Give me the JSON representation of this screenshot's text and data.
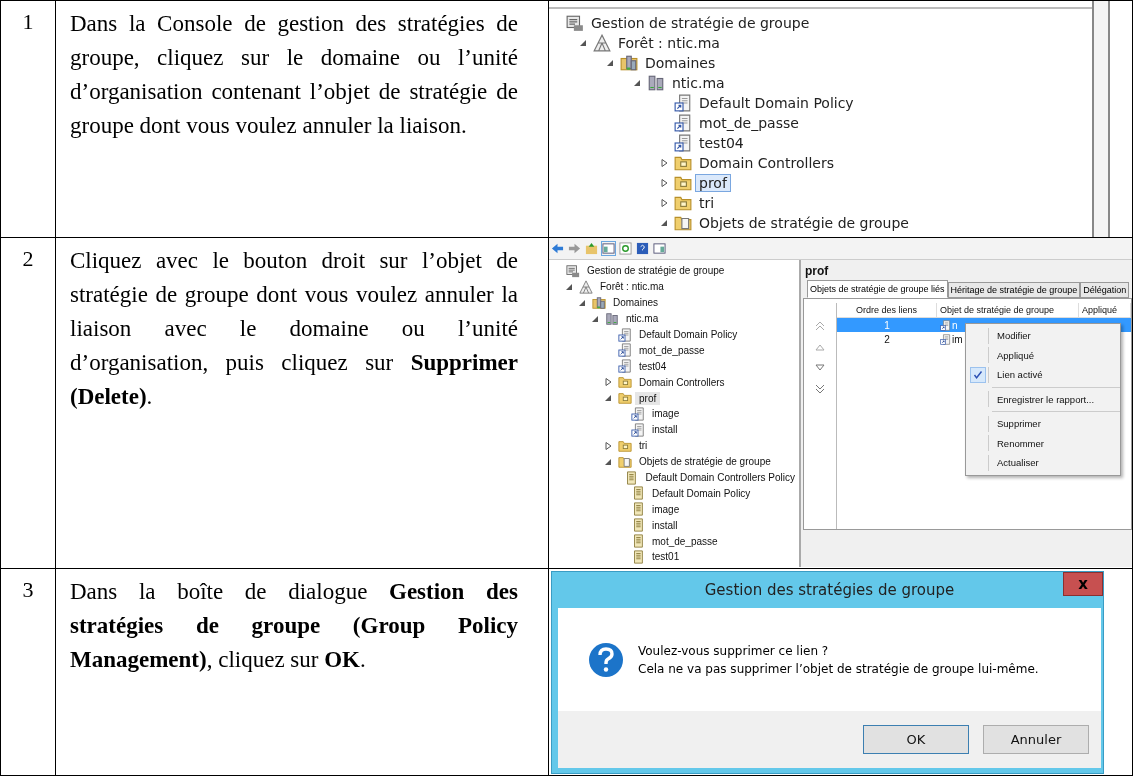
{
  "steps": [
    {
      "number": "1",
      "instruction": "Dans la Console de gestion des stratégies de groupe, cliquez sur le domaine ou l’unité d’organisation contenant l’objet de stratégie de groupe dont vous voulez annuler la liaison.",
      "screen": {
        "kind": "tree",
        "tree": [
          {
            "label": "Gestion de stratégie de groupe",
            "kind": "console",
            "selected": false,
            "children": [
              {
                "label": "Forêt : ntic.ma",
                "kind": "forest",
                "expanded": true,
                "selected": false,
                "children": [
                  {
                    "label": "Domaines",
                    "kind": "domains",
                    "expanded": true,
                    "selected": false,
                    "children": [
                      {
                        "label": "ntic.ma",
                        "kind": "domain",
                        "expanded": true,
                        "selected": false,
                        "children": [
                          {
                            "label": "Default Domain Policy",
                            "kind": "gpo-link",
                            "selected": false
                          },
                          {
                            "label": "mot_de_passe",
                            "kind": "gpo-link",
                            "selected": false
                          },
                          {
                            "label": "test04",
                            "kind": "gpo-link",
                            "selected": false
                          },
                          {
                            "label": "Domain Controllers",
                            "kind": "ou",
                            "expanded": false,
                            "selected": false
                          },
                          {
                            "label": "prof",
                            "kind": "ou",
                            "expanded": false,
                            "selected": true
                          },
                          {
                            "label": "tri",
                            "kind": "ou",
                            "expanded": false,
                            "selected": false
                          },
                          {
                            "label": "Objets de stratégie de groupe",
                            "kind": "gpo-folder",
                            "expanded": true,
                            "selected": false
                          }
                        ]
                      }
                    ]
                  }
                ]
              }
            ]
          }
        ]
      }
    },
    {
      "number": "2",
      "instruction": "Cliquez avec le bouton droit sur l’objet de stratégie de groupe dont vous voulez annuler la liaison avec le domaine ou l’unité d’organisation, puis cliquez sur **Supprimer (Delete)**.",
      "screen": {
        "kind": "console",
        "tree": [
          {
            "label": "Gestion de stratégie de groupe",
            "kind": "console",
            "selected": false,
            "children": [
              {
                "label": "Forêt : ntic.ma",
                "kind": "forest",
                "expanded": true,
                "selected": false,
                "children": [
                  {
                    "label": "Domaines",
                    "kind": "domains",
                    "expanded": true,
                    "selected": false,
                    "children": [
                      {
                        "label": "ntic.ma",
                        "kind": "domain",
                        "expanded": true,
                        "selected": false,
                        "children": [
                          {
                            "label": "Default Domain Policy",
                            "kind": "gpo-link",
                            "selected": false
                          },
                          {
                            "label": "mot_de_passe",
                            "kind": "gpo-link",
                            "selected": false
                          },
                          {
                            "label": "test04",
                            "kind": "gpo-link",
                            "selected": false
                          },
                          {
                            "label": "Domain Controllers",
                            "kind": "ou",
                            "expanded": false,
                            "selected": false
                          },
                          {
                            "label": "prof",
                            "kind": "ou",
                            "expanded": true,
                            "selected": true,
                            "children": [
                              {
                                "label": "image",
                                "kind": "gpo-link",
                                "selected": false
                              },
                              {
                                "label": "install",
                                "kind": "gpo-link",
                                "selected": false
                              }
                            ]
                          },
                          {
                            "label": "tri",
                            "kind": "ou",
                            "expanded": false,
                            "selected": false
                          },
                          {
                            "label": "Objets de stratégie de groupe",
                            "kind": "gpo-folder",
                            "expanded": true,
                            "selected": false,
                            "children": [
                              {
                                "label": "Default Domain Controllers Policy",
                                "kind": "gpo",
                                "selected": false
                              },
                              {
                                "label": "Default Domain Policy",
                                "kind": "gpo",
                                "selected": false
                              },
                              {
                                "label": "image",
                                "kind": "gpo",
                                "selected": false
                              },
                              {
                                "label": "install",
                                "kind": "gpo",
                                "selected": false
                              },
                              {
                                "label": "mot_de_passe",
                                "kind": "gpo",
                                "selected": false
                              },
                              {
                                "label": "test01",
                                "kind": "gpo",
                                "selected": false
                              }
                            ]
                          }
                        ]
                      }
                    ]
                  }
                ]
              }
            ]
          }
        ],
        "panel": {
          "heading": "prof",
          "tabs": [
            {
              "label": "Objets de stratégie de groupe liés",
              "selected": true
            },
            {
              "label": "Héritage de stratégie de groupe",
              "selected": false
            },
            {
              "label": "Délégation",
              "selected": false
            }
          ],
          "columns": [
            "Ordre des liens",
            "Objet de stratégie de groupe",
            "Appliqué"
          ],
          "rows": [
            {
              "order": "1",
              "object": "n",
              "selected": true
            },
            {
              "order": "2",
              "object": "im",
              "selected": false
            }
          ],
          "context_menu": [
            [
              {
                "label": "Modifier",
                "checked": false
              },
              {
                "label": "Appliqué",
                "checked": false
              },
              {
                "label": "Lien activé",
                "checked": true
              }
            ],
            [
              {
                "label": "Enregistrer le rapport...",
                "checked": false
              }
            ],
            [
              {
                "label": "Supprimer",
                "checked": false
              },
              {
                "label": "Renommer",
                "checked": false
              },
              {
                "label": "Actualiser",
                "checked": false
              }
            ]
          ]
        }
      }
    },
    {
      "number": "3",
      "instruction": "Dans la boîte de dialogue **Gestion des stratégies de groupe (Group Policy Management)**, cliquez sur **OK**.",
      "screen": {
        "kind": "dialog",
        "title": "Gestion des stratégies de groupe",
        "close": "x",
        "message": [
          "Voulez-vous supprimer ce lien ?",
          "Cela ne va pas supprimer l’objet de stratégie de groupe lui-même."
        ],
        "buttons": [
          {
            "label": "OK",
            "selected": true
          },
          {
            "label": "Annuler",
            "selected": false
          }
        ]
      }
    }
  ]
}
